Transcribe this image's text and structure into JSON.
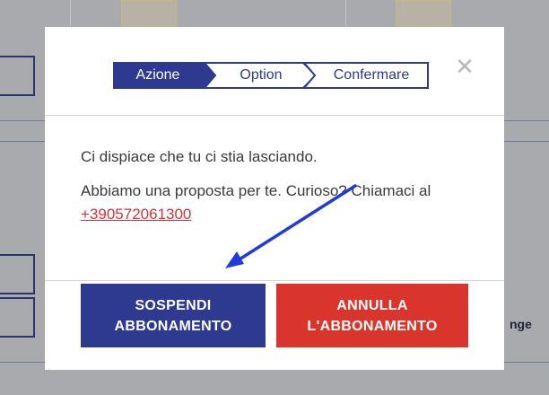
{
  "background": {
    "partial_text": "nge"
  },
  "modal": {
    "close_symbol": "✕",
    "steps": [
      {
        "label": "Azione",
        "active": true
      },
      {
        "label": "Option",
        "active": false
      },
      {
        "label": "Confermare",
        "active": false
      }
    ],
    "message_line1": "Ci dispiace che tu ci stia lasciando.",
    "message_line2": "Abbiamo una proposta per te. Curioso? Chiamaci al",
    "phone": "+390572061300",
    "suspend_button": "SOSPENDI ABBONAMENTO",
    "cancel_button": "ANNULLA L'ABBONAMENTO"
  },
  "colors": {
    "primary": "#2d3a8f",
    "danger": "#d9352c",
    "link": "#d4343b",
    "overlay": "#a9aaad",
    "annotation_arrow": "#1f3bdc"
  }
}
